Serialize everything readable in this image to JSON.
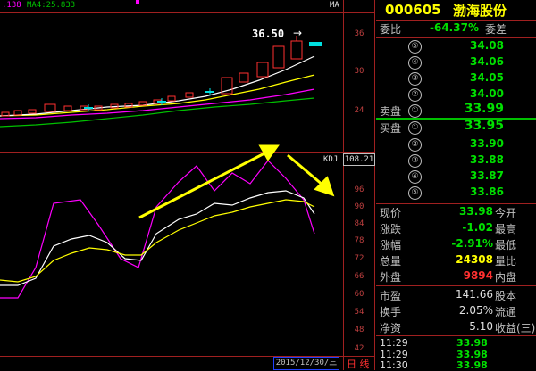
{
  "topbar": {
    "ma_left": ".138",
    "ma4": "MA4:25.833",
    "ma_right": "MA"
  },
  "price_tag": "36.50",
  "arrow_right": "→",
  "y_axis_top": [
    "36",
    "30",
    "24"
  ],
  "kdj_label": "KDJ",
  "kdj_value": "108.21",
  "y_axis_bottom": [
    "96",
    "90",
    "84",
    "78",
    "72",
    "66",
    "60",
    "54",
    "48",
    "42"
  ],
  "date_label": "2015/12/30/三",
  "period_label": "日 线",
  "stock": {
    "code": "000605",
    "name": "渤海股份"
  },
  "weibi": {
    "label": "委比",
    "value": "-64.37%",
    "label2": "委差"
  },
  "sell_orders": [
    {
      "level": "⑤",
      "price": "34.08"
    },
    {
      "level": "④",
      "price": "34.06"
    },
    {
      "level": "③",
      "price": "34.05"
    },
    {
      "level": "②",
      "price": "34.00"
    },
    {
      "level": "①",
      "price": "33.99",
      "label": "卖盘"
    }
  ],
  "buy_orders": [
    {
      "level": "①",
      "price": "33.95",
      "label": "买盘"
    },
    {
      "level": "②",
      "price": "33.90"
    },
    {
      "level": "③",
      "price": "33.88"
    },
    {
      "level": "④",
      "price": "33.87"
    },
    {
      "level": "⑤",
      "price": "33.86"
    }
  ],
  "quote": [
    {
      "label": "现价",
      "value": "33.98",
      "label2": "今开",
      "color": "#00e000"
    },
    {
      "label": "涨跌",
      "value": "-1.02",
      "label2": "最高",
      "color": "#00e000"
    },
    {
      "label": "涨幅",
      "value": "-2.91%",
      "label2": "最低",
      "color": "#00e000"
    },
    {
      "label": "总量",
      "value": "24308",
      "label2": "量比",
      "color": "#ffff00"
    },
    {
      "label": "外盘",
      "value": "9894",
      "label2": "内盘",
      "color": "#ff3030"
    }
  ],
  "fundamentals": [
    {
      "label": "市盈",
      "value": "141.66",
      "label2": "股本"
    },
    {
      "label": "换手",
      "value": "2.05%",
      "label2": "流通"
    },
    {
      "label": "净资",
      "value": "5.10",
      "label2": "收益(三)"
    }
  ],
  "ticks": [
    {
      "time": "11:29",
      "price": "33.98"
    },
    {
      "time": "11:29",
      "price": "33.98"
    },
    {
      "time": "11:30",
      "price": "33.98"
    }
  ],
  "colors": {
    "grid": "#a02020",
    "up": "#ff3030",
    "down": "#00e000",
    "ma_white": "#ffffff",
    "ma_yellow": "#ffff00",
    "ma_magenta": "#ff00ff",
    "ma_green": "#00c000",
    "arrow": "#ffff00"
  }
}
